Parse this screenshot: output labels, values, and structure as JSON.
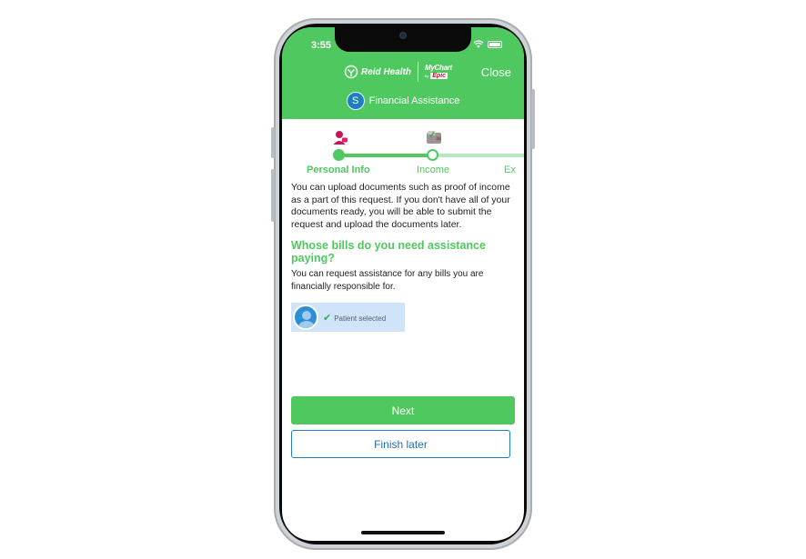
{
  "status_bar": {
    "time": "3:55"
  },
  "header": {
    "reid_logo_text": "Reid Health",
    "mychart_logo_text": "MyChart",
    "by_text": "by",
    "epic_text": "Epic",
    "close_label": "Close",
    "avatar_letter": "S",
    "title": "Financial Assistance"
  },
  "stepper": {
    "steps": [
      {
        "label": "Personal Info",
        "state": "active",
        "icon": "person-icon"
      },
      {
        "label": "Income",
        "state": "todo",
        "icon": "wallet-icon"
      },
      {
        "label": "Ex",
        "state": "todo",
        "icon": ""
      }
    ]
  },
  "content": {
    "intro": "You can upload documents such as proof of income as a part of this request. If you don't have all of your documents ready, you will be able to submit the request and upload the documents later.",
    "question": "Whose bills do you need assistance paying?",
    "sub": "You can request assistance for any bills you are financially responsible for.",
    "patient_status": "Patient selected"
  },
  "actions": {
    "next_label": "Next",
    "finish_label": "Finish later"
  },
  "colors": {
    "accent_green": "#4fc95f",
    "link_blue": "#1f6fb5",
    "selected_bg": "#cfe3fb",
    "epic_red": "#c8102e"
  }
}
